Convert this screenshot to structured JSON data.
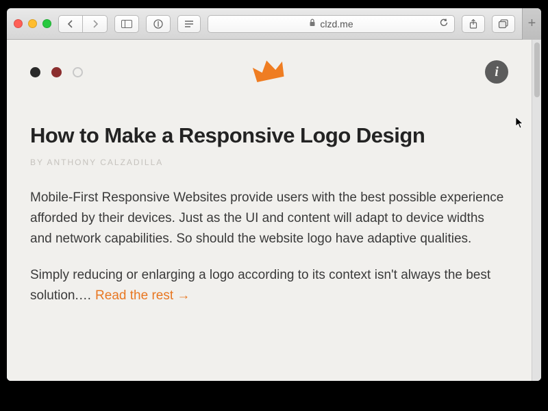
{
  "browser": {
    "url_host": "clzd.me"
  },
  "page": {
    "title": "How to Make a Responsive Logo Design",
    "byline_prefix": "BY ",
    "author": "ANTHONY CALZADILLA",
    "paragraph1": "Mobile-First Responsive Websites provide users with the best possible experience afforded by their devices. Just as the UI and content will adapt to device widths and network capabilities. So should the website logo have adaptive qualities.",
    "paragraph2_prefix": "Simply reducing or enlarging a logo according to its context isn't always the best solution.… ",
    "read_more": "Read the rest",
    "info_badge": "i"
  }
}
